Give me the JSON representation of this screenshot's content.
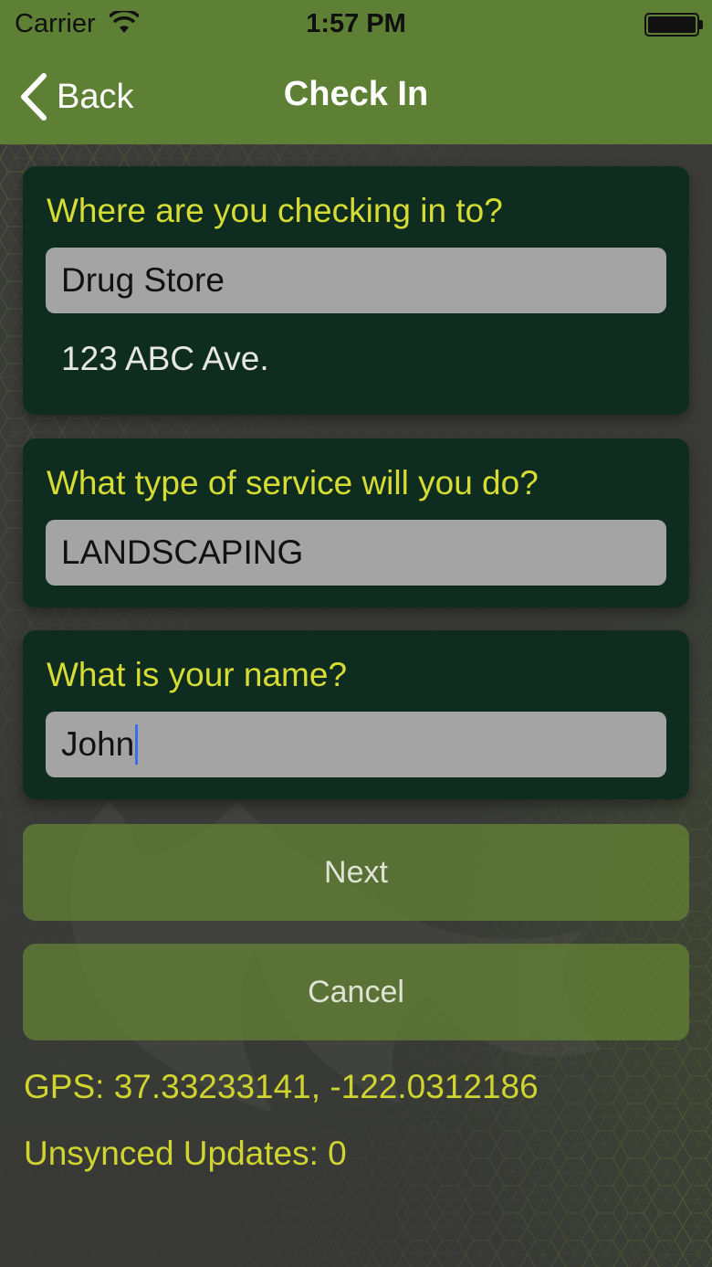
{
  "status_bar": {
    "carrier": "Carrier",
    "time": "1:57 PM"
  },
  "nav": {
    "back_label": "Back",
    "title": "Check In"
  },
  "checkin_card": {
    "label": "Where are you checking in to?",
    "location_value": "Drug Store",
    "address": "123 ABC Ave."
  },
  "service_card": {
    "label": "What type of service will you do?",
    "service_value": "LANDSCAPING"
  },
  "name_card": {
    "label": "What is your name?",
    "name_value": "John"
  },
  "buttons": {
    "next_label": "Next",
    "cancel_label": "Cancel"
  },
  "footer": {
    "gps": "GPS: 37.33233141, -122.0312186",
    "unsynced": "Unsynced Updates: 0"
  },
  "colors": {
    "bar_green": "#5d8035",
    "card_dark": "#0e2d20",
    "label_yellow": "#d6dc34",
    "button_green": "#628034",
    "caret_blue": "#3b6cf0"
  }
}
